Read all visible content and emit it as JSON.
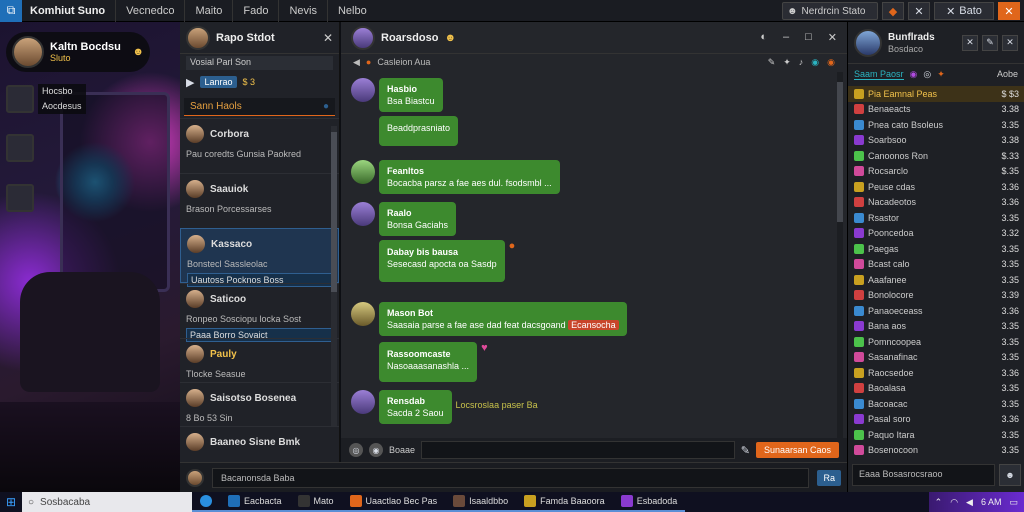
{
  "app": {
    "title": "Komhiut Suno",
    "menus": [
      "Vecnedco",
      "Maito",
      "Fado",
      "Nevis",
      "Nelbo"
    ]
  },
  "topbar": {
    "user": "Nerdrcin Stato",
    "btn": "Bato"
  },
  "profile": {
    "name": "Kaltn Bocdsu",
    "sub": "Sluto"
  },
  "side_friends": [
    {
      "line1": "Hocsbo",
      "line2": "Aocdesus"
    },
    {
      "line1": "",
      "line2": ""
    },
    {
      "line1": "",
      "line2": ""
    }
  ],
  "convs": {
    "title": "Rapo Stdot",
    "status": "Vosial Parl Son",
    "chip": "Lanrao",
    "count": "$ 3",
    "search": "Sann Haols",
    "items": [
      {
        "name": "Corbora",
        "preview": "Pau coredts Gunsia Paokred"
      },
      {
        "name": "Saauiok",
        "preview": "Brason Porcessarses"
      },
      {
        "name": "Kassaco",
        "preview": "Bonstecl Sassleolac",
        "hl": "Uautoss Pocknos Boss"
      },
      {
        "name": "Saticoo",
        "preview": "Ronpeo Sosciopu locka Sost",
        "hl": "Paaa Borro Sovaict"
      },
      {
        "name": "Pauly",
        "preview": "Tlocke Seasue"
      },
      {
        "name": "Saisotso Bosenea",
        "preview": "8 Bo 53 Sin"
      },
      {
        "name": "Baaneo Sisne Bmk",
        "preview": ""
      }
    ]
  },
  "chat": {
    "title": "Roarsdoso",
    "sub": "Casleion Aua",
    "messages": [
      {
        "name": "Hasbio",
        "text": "Bsa Biastcu"
      },
      {
        "name": "",
        "text": "Beaddprasniato"
      },
      {
        "name": "Feanltos",
        "text": "Bocacba parsz a fae aes dul. fsodsmbl ..."
      },
      {
        "name": "Raalo",
        "text": "Bonsa Gaciahs"
      },
      {
        "name": "Dabay bis bausa",
        "text": "Sesecasd apocta oa Sasdp"
      },
      {
        "name": "Mason Bot",
        "text": "Saasaia parse a fae ase dad feat dacsgoand",
        "tag": "Ecansocha"
      },
      {
        "name": "Rassoomcaste",
        "text": "Nasoaaasanashla ..."
      },
      {
        "name": "Rensdab",
        "text": "Sacda 2 Saou",
        "extra": "Locsroslaa paser Ba"
      }
    ],
    "compose_label": "Boaae",
    "send": "Sunaarsan Caos"
  },
  "bottom": {
    "placeholder": "Bacanonsda Baba",
    "btn": "Ra"
  },
  "right": {
    "title": "Bunflrads",
    "subtitle": "Bosdaco",
    "tab_on": "Saam Paosr",
    "tab_off": "Aobe",
    "rows": [
      {
        "name": "Pia Eamnal Peas",
        "value": "$ $3",
        "sel": true
      },
      {
        "name": "Benaeacts",
        "value": "3.38"
      },
      {
        "name": "Pnea cato Bsoleus",
        "value": "3.35"
      },
      {
        "name": "Soarbsoo",
        "value": "3.38"
      },
      {
        "name": "Canoonos Ron",
        "value": "$.33"
      },
      {
        "name": "Rocsarclo",
        "value": "$.35"
      },
      {
        "name": "Peuse cdas",
        "value": "3.36"
      },
      {
        "name": "Nacadeotos",
        "value": "3.36"
      },
      {
        "name": "Rsastor",
        "value": "3.35"
      },
      {
        "name": "Pooncedoa",
        "value": "3.32"
      },
      {
        "name": "Paegas",
        "value": "3.35"
      },
      {
        "name": "Bcast calo",
        "value": "3.35"
      },
      {
        "name": "Aaafanee",
        "value": "3.35"
      },
      {
        "name": "Bonolocore",
        "value": "3.39"
      },
      {
        "name": "Panaoeceass",
        "value": "3.36"
      },
      {
        "name": "Bana aos",
        "value": "3.35"
      },
      {
        "name": "Pomncoopea",
        "value": "3.35"
      },
      {
        "name": "Sasanafinac",
        "value": "3.35"
      },
      {
        "name": "Raocsedoe",
        "value": "3.36"
      },
      {
        "name": "Baoalasa",
        "value": "3.35"
      },
      {
        "name": "Bacoacac",
        "value": "3.35"
      },
      {
        "name": "Pasal soro",
        "value": "3.36"
      },
      {
        "name": "Paquo Itara",
        "value": "3.35"
      },
      {
        "name": "Bosenocoon",
        "value": "3.35"
      }
    ],
    "foot_placeholder": "Eaaa Bosasrocsraoo"
  },
  "taskbar": {
    "search": "Sosbacaba",
    "apps": [
      "Eacbacta",
      "Mato",
      "Uaactlao Bec Pas",
      "Isaaldbbo",
      "Famda Baaoora",
      "Esbadoda"
    ],
    "time": "6 AM"
  },
  "colors": {
    "accent": "#e0661b",
    "bubble": "#3d8a2e",
    "selection": "#1f3550"
  }
}
